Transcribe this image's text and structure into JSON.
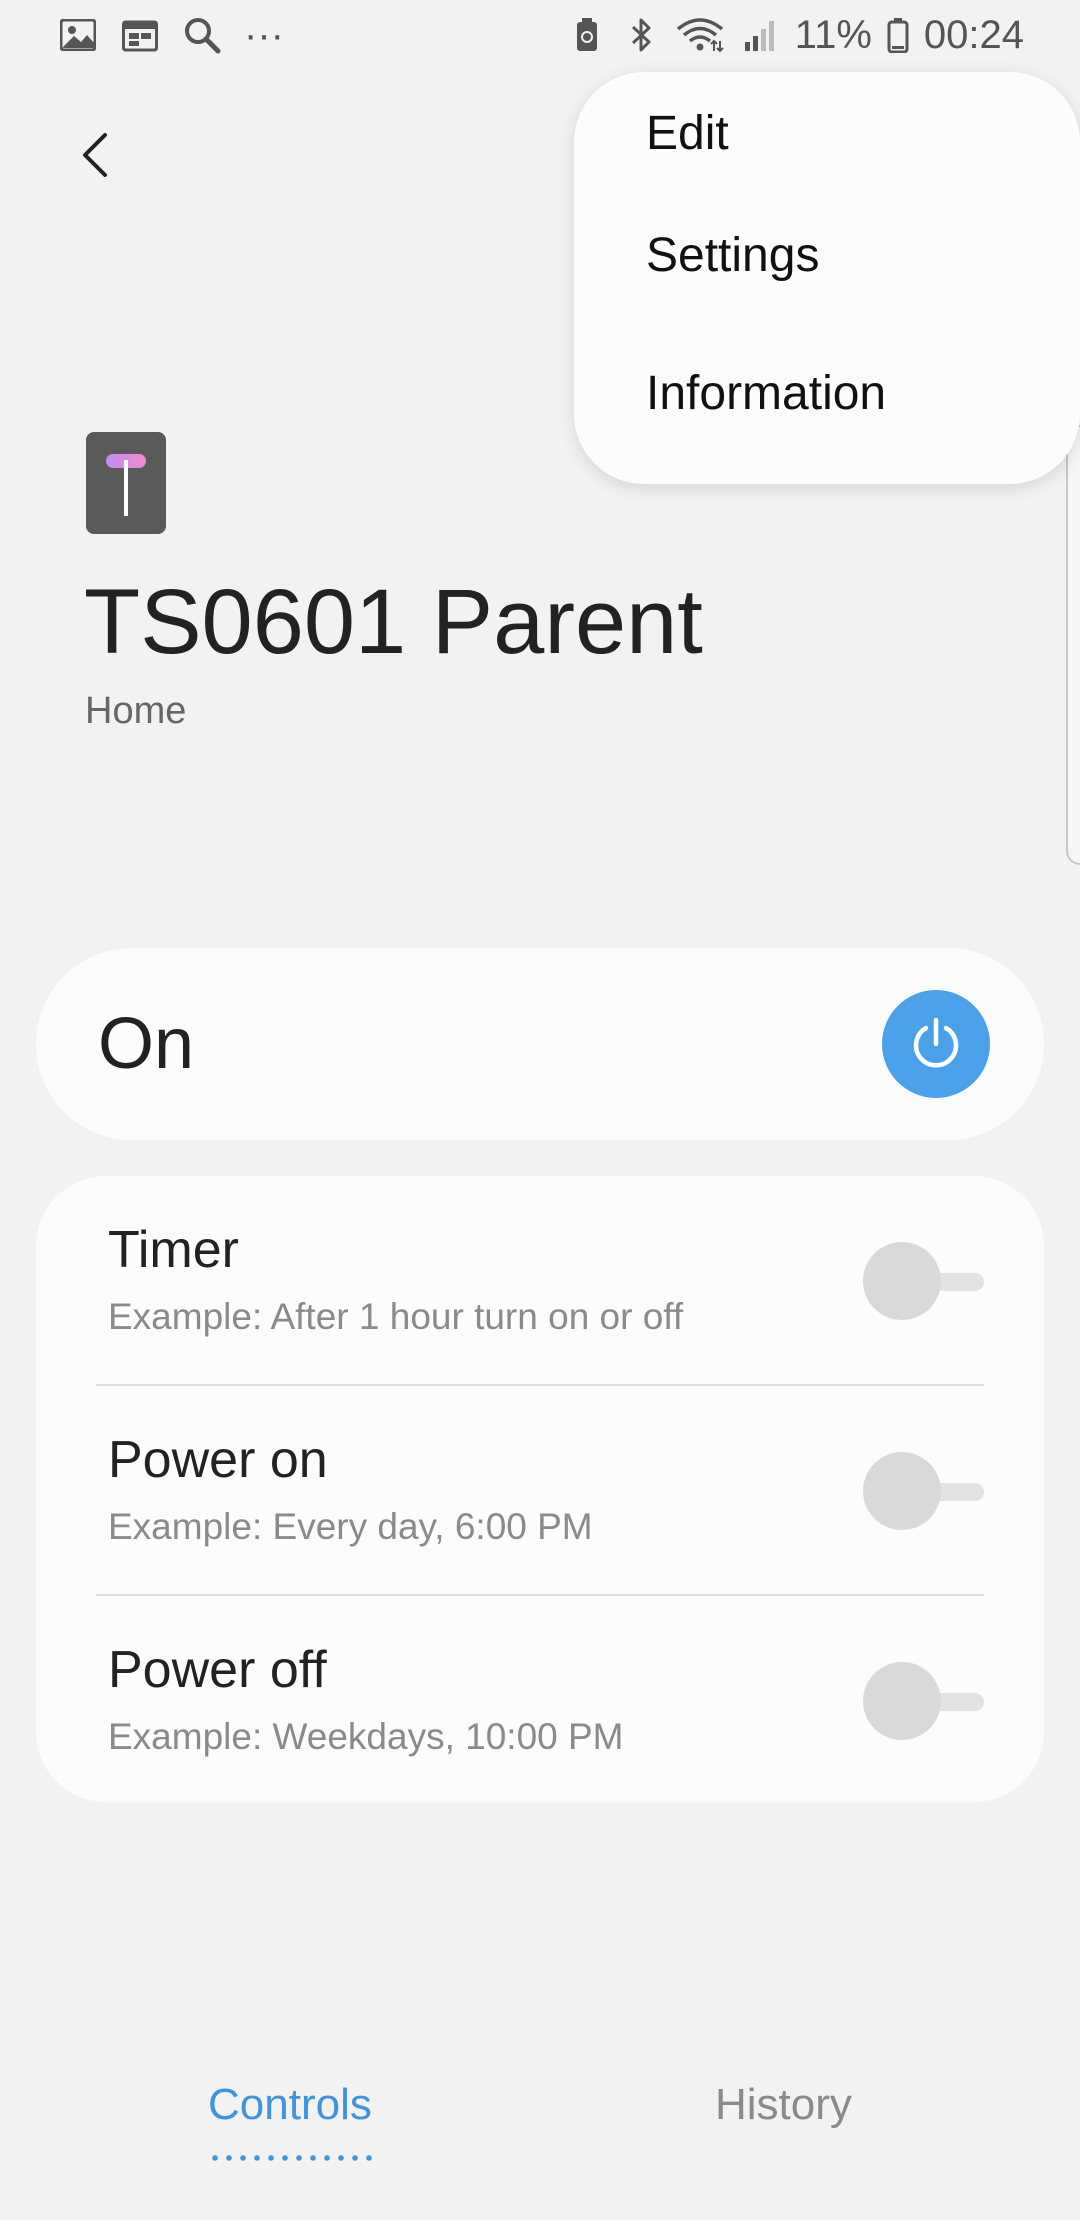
{
  "status_bar": {
    "left_icons": [
      "image-icon",
      "calendar-icon",
      "search-icon",
      "more-icon"
    ],
    "more_label": "···",
    "right_icons": [
      "battery-saver-icon",
      "bluetooth-icon",
      "wifi-icon",
      "signal-icon"
    ],
    "battery_percent": "11%",
    "time": "00:24"
  },
  "menu": {
    "items": [
      {
        "label": "Edit"
      },
      {
        "label": "Settings"
      },
      {
        "label": "Information"
      }
    ]
  },
  "device": {
    "icon": "device-t-icon",
    "name": "TS0601 Parent",
    "location": "Home"
  },
  "power_card": {
    "state_label": "On",
    "button_color": "#4aa1e9",
    "icon": "power-icon"
  },
  "schedules": [
    {
      "title": "Timer",
      "subtitle": "Example: After 1 hour turn on or off",
      "enabled": false
    },
    {
      "title": "Power on",
      "subtitle": "Example: Every day, 6:00 PM",
      "enabled": false
    },
    {
      "title": "Power off",
      "subtitle": "Example: Weekdays, 10:00 PM",
      "enabled": false
    }
  ],
  "tabs": [
    {
      "label": "Controls",
      "active": true,
      "color": "#3f95db"
    },
    {
      "label": "History",
      "active": false,
      "color": "#8a8a8a"
    }
  ]
}
